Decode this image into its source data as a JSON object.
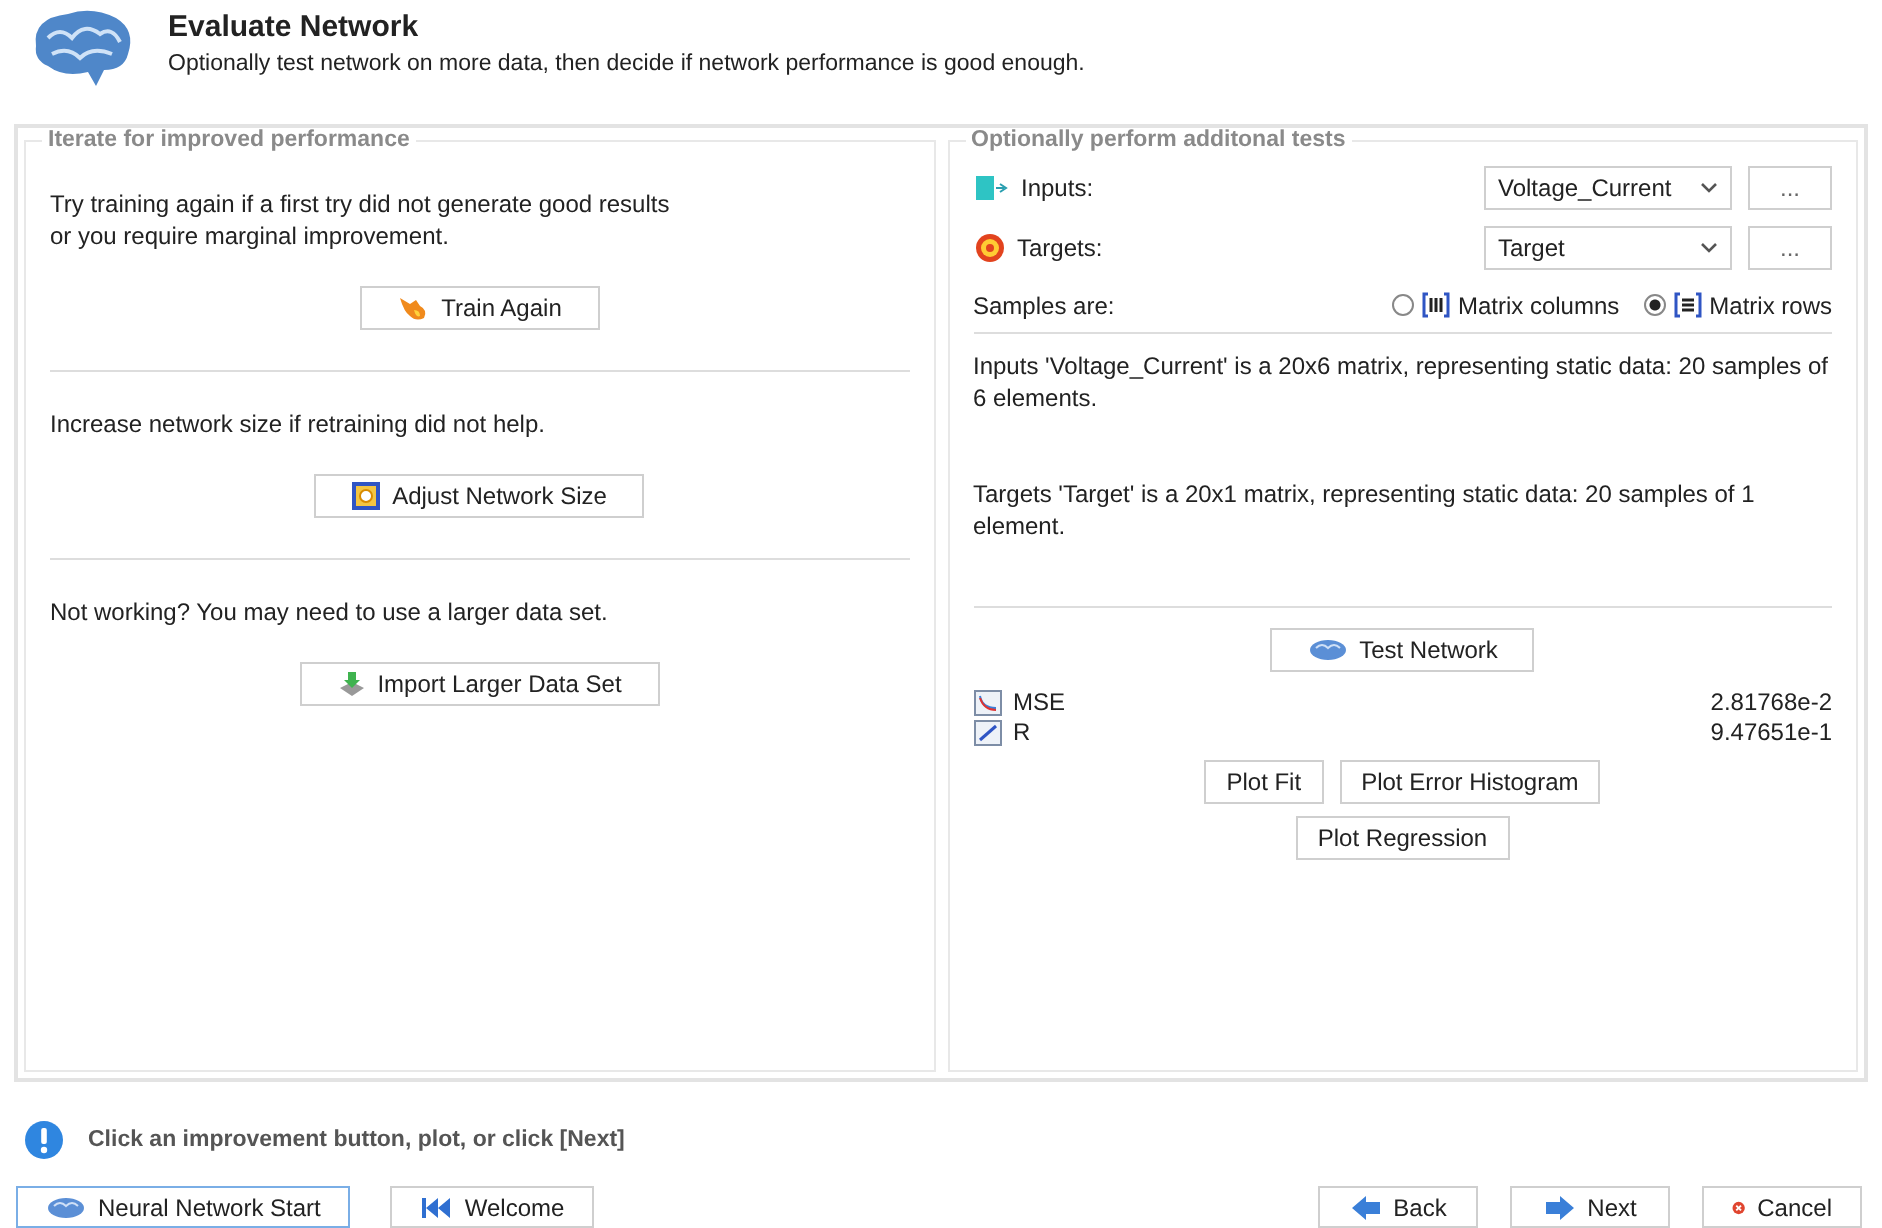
{
  "header": {
    "title": "Evaluate Network",
    "subtitle": "Optionally test network on more data, then decide if network performance is good enough."
  },
  "left": {
    "title": "Iterate for improved performance",
    "sections": [
      {
        "text": "Try training again if a first try did not generate good results\nor you require marginal improvement.",
        "button": {
          "label": "Train Again",
          "kind": "flame"
        }
      },
      {
        "text": "Increase network size if retraining did not help.",
        "button": {
          "label": "Adjust Network Size",
          "kind": "resize"
        }
      },
      {
        "text": "Not working? You may need to use a larger data set.",
        "button": {
          "label": "Import Larger Data Set",
          "kind": "import"
        }
      }
    ]
  },
  "right": {
    "title": "Optionally perform additonal tests",
    "selectors": [
      {
        "kind": "inputs",
        "label": "Inputs:",
        "value": "Voltage_Current",
        "browse": "..."
      },
      {
        "kind": "targets",
        "label": "Targets:",
        "value": "Target",
        "browse": "..."
      }
    ],
    "samples": {
      "label": "Samples are:",
      "options": [
        {
          "kind": "columns",
          "label": "Matrix columns",
          "selected": false
        },
        {
          "kind": "rows",
          "label": "Matrix rows",
          "selected": true
        }
      ]
    },
    "descriptions": [
      "Inputs 'Voltage_Current' is a 20x6 matrix, representing static data: 20 samples of 6 elements.",
      "Targets 'Target' is a 20x1 matrix, representing static data: 20 samples of 1 element."
    ],
    "test_button": {
      "label": "Test Network",
      "kind": "brain"
    },
    "metrics": [
      {
        "kind": "mse",
        "name": "MSE",
        "value": "2.81768e-2"
      },
      {
        "kind": "r",
        "name": "R",
        "value": "9.47651e-1"
      }
    ],
    "plot_rows": [
      [
        "Plot Fit",
        "Plot Error Histogram"
      ],
      [
        "Plot Regression"
      ]
    ]
  },
  "footer": {
    "status": "Click an improvement button, plot, or click [Next]",
    "nav_left": [
      {
        "kind": "brain",
        "label": "Neural Network Start"
      },
      {
        "kind": "welcome",
        "label": "Welcome"
      }
    ],
    "nav_right": [
      {
        "kind": "back",
        "label": "Back"
      },
      {
        "kind": "next",
        "label": "Next"
      },
      {
        "kind": "cancel",
        "label": "Cancel"
      }
    ]
  }
}
